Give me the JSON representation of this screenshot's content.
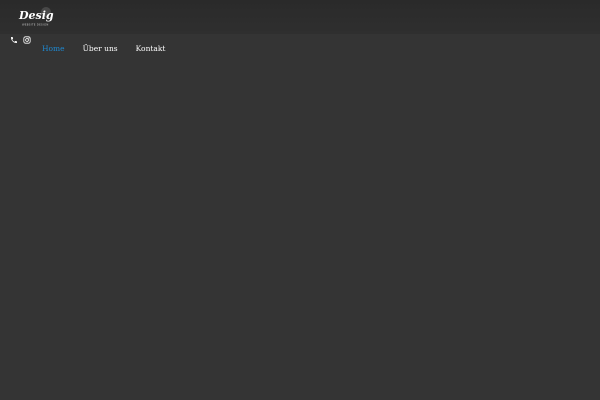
{
  "logo": {
    "text": "Design",
    "tagline": "WEBSITE DESIGN",
    "icon": "logo-image"
  },
  "social": [
    {
      "icon": "phone-icon",
      "label": "Phone"
    },
    {
      "icon": "instagram-icon",
      "label": "Instagram"
    }
  ],
  "nav": {
    "items": [
      {
        "label": "Home",
        "active": true
      },
      {
        "label": "Über uns",
        "active": false
      },
      {
        "label": "Kontakt",
        "active": false
      }
    ]
  },
  "colors": {
    "background": "#343434",
    "header": "#2c2c2c",
    "accent": "#1e88d0",
    "text": "#ffffff"
  }
}
